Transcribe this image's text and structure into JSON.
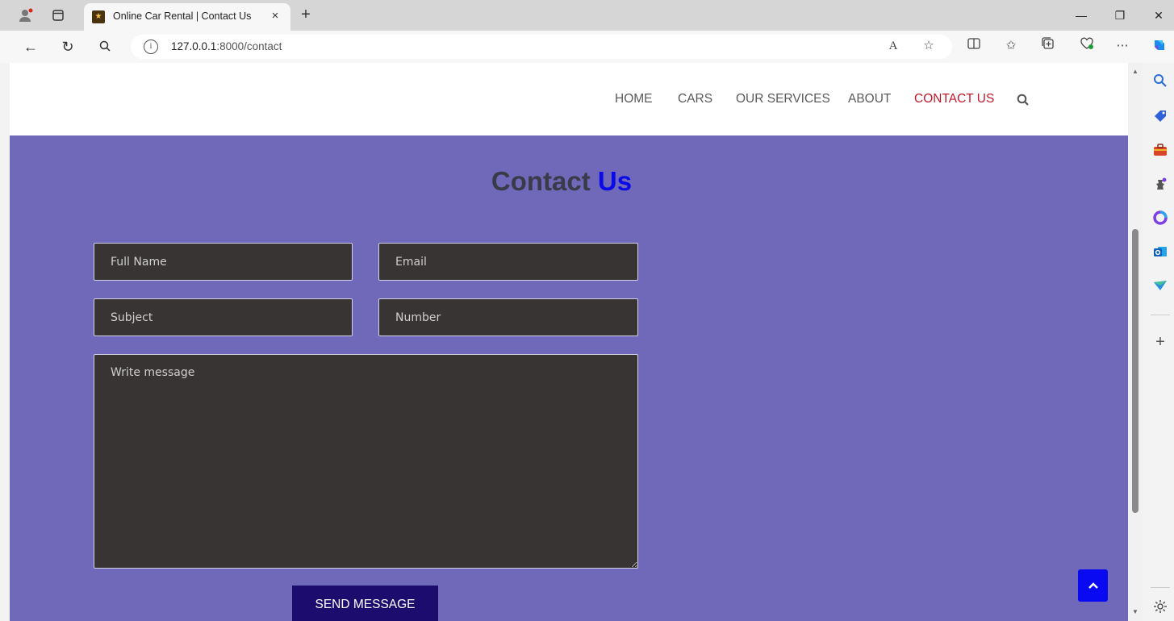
{
  "browser": {
    "tab_title": "Online Car Rental | Contact Us",
    "tab_close": "×",
    "new_tab": "+",
    "url_host": "127.0.0.1",
    "url_rest": ":8000/contact",
    "window": {
      "minimize": "—",
      "restore": "❐",
      "close": "✕"
    },
    "nav": {
      "back": "←",
      "reload": "↻"
    }
  },
  "site": {
    "nav_items": [
      "HOME",
      "CARS",
      "OUR SERVICES",
      "ABOUT",
      "CONTACT US"
    ],
    "active_nav": "CONTACT US",
    "accent_color": "#c0182a"
  },
  "contact": {
    "title_main": "Contact ",
    "title_accent": "Us",
    "background": "#7068b8",
    "fields": {
      "full_name_placeholder": "Full Name",
      "email_placeholder": "Email",
      "subject_placeholder": "Subject",
      "number_placeholder": "Number",
      "message_placeholder": "Write message"
    },
    "send_label": "Send Message"
  }
}
